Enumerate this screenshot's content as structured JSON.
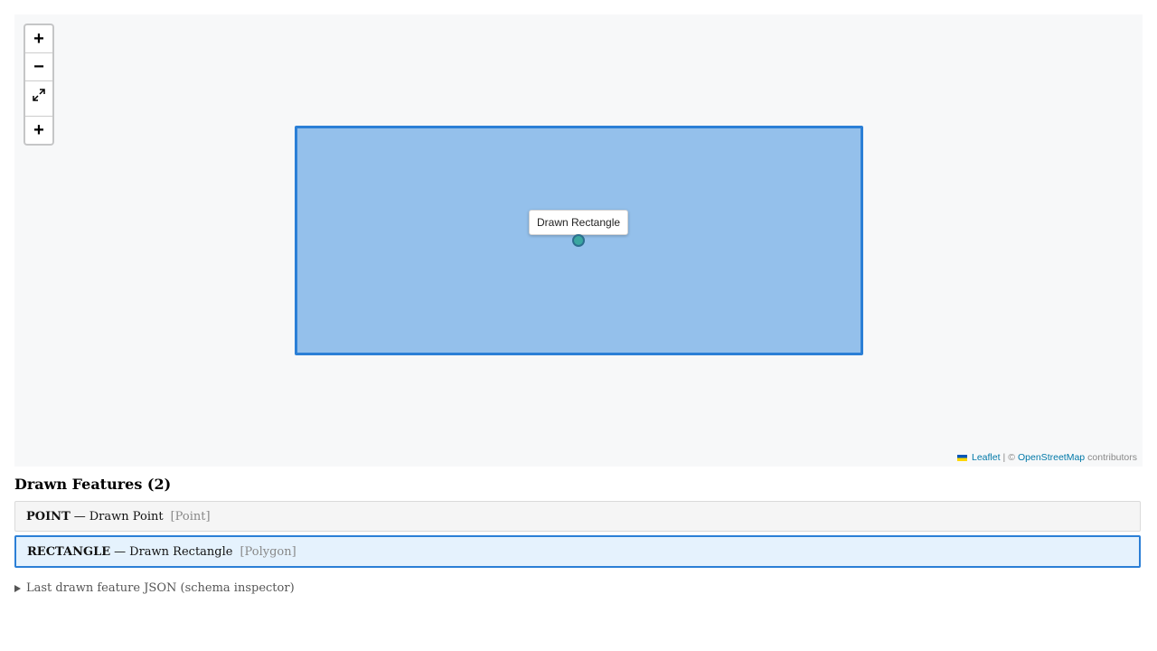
{
  "map": {
    "controls": {
      "zoom_in": "+",
      "zoom_out": "−",
      "fullscreen_icon": "expand-icon",
      "draw": "+"
    },
    "tooltip": "Drawn Rectangle",
    "attribution": {
      "leaflet": "Leaflet",
      "separator": "|",
      "copyright": "©",
      "osm": "OpenStreetMap",
      "contributors": "contributors"
    },
    "colors": {
      "rectangle_stroke": "#2b7fd6",
      "rectangle_fill": "#3288dd",
      "marker_fill": "#3aa6a0"
    }
  },
  "features": {
    "title": "Drawn Features (2)",
    "items": [
      {
        "kind": "POINT",
        "sep": "—",
        "name": "Drawn Point",
        "geometry": "[Point]"
      },
      {
        "kind": "RECTANGLE",
        "sep": "—",
        "name": "Drawn Rectangle",
        "geometry": "[Polygon]"
      }
    ],
    "selected_index": 1
  },
  "inspector": {
    "summary": "Last drawn feature JSON (schema inspector)"
  }
}
